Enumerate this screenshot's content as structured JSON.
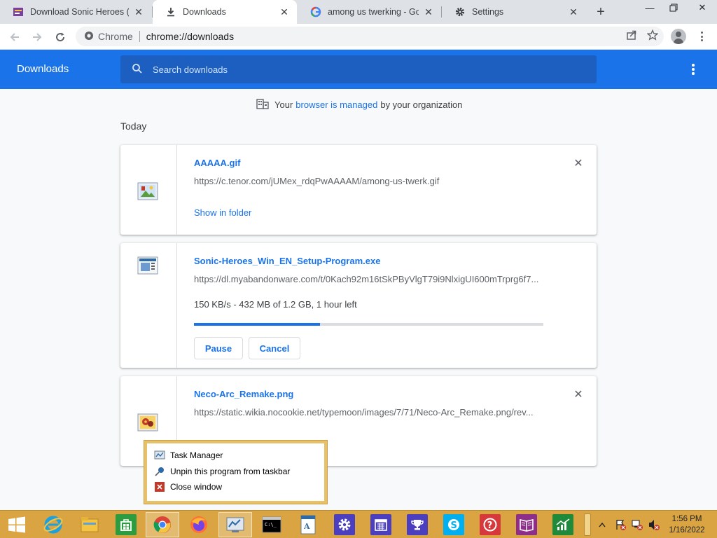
{
  "tabs": [
    {
      "title": "Download Sonic Heroes (Windows)",
      "icon": "sonic-favicon"
    },
    {
      "title": "Downloads",
      "icon": "download-icon",
      "active": true
    },
    {
      "title": "among us twerking - Google Search",
      "icon": "google-icon"
    },
    {
      "title": "Settings",
      "icon": "gear-icon"
    }
  ],
  "toolbar": {
    "site_label": "Chrome",
    "url": "chrome://downloads"
  },
  "downloads_page": {
    "title": "Downloads",
    "search_placeholder": "Search downloads",
    "managed_prefix": "Your",
    "managed_link": "browser is managed",
    "managed_suffix": "by your organization",
    "section_label": "Today"
  },
  "items": [
    {
      "filename": "AAAAA.gif",
      "url": "https://c.tenor.com/jUMex_rdqPwAAAAM/among-us-twerk.gif",
      "action_link": "Show in folder",
      "icon": "image-file-icon"
    },
    {
      "filename": "Sonic-Heroes_Win_EN_Setup-Program.exe",
      "url": "https://dl.myabandonware.com/t/0Kach92m16tSkPByVlgT79i9NlxigUI600mTrprg6f7...",
      "status": "150 KB/s - 432 MB of 1.2 GB, 1 hour left",
      "progress": 0.36,
      "pause_label": "Pause",
      "cancel_label": "Cancel",
      "icon": "exe-file-icon"
    },
    {
      "filename": "Neco-Arc_Remake.png",
      "url": "https://static.wikia.nocookie.net/typemoon/images/7/71/Neco-Arc_Remake.png/rev...",
      "icon": "image-file-icon"
    }
  ],
  "jump_list": {
    "items": [
      {
        "label": "Task Manager",
        "icon": "task-manager-icon"
      },
      {
        "label": "Unpin this program from taskbar",
        "icon": "unpin-icon"
      },
      {
        "label": "Close window",
        "icon": "close-window-icon"
      }
    ]
  },
  "taskbar": {
    "time": "1:56 PM",
    "date": "1/16/2022"
  },
  "colors": {
    "accent": "#1a73e8",
    "taskbar": "#d9a441"
  }
}
